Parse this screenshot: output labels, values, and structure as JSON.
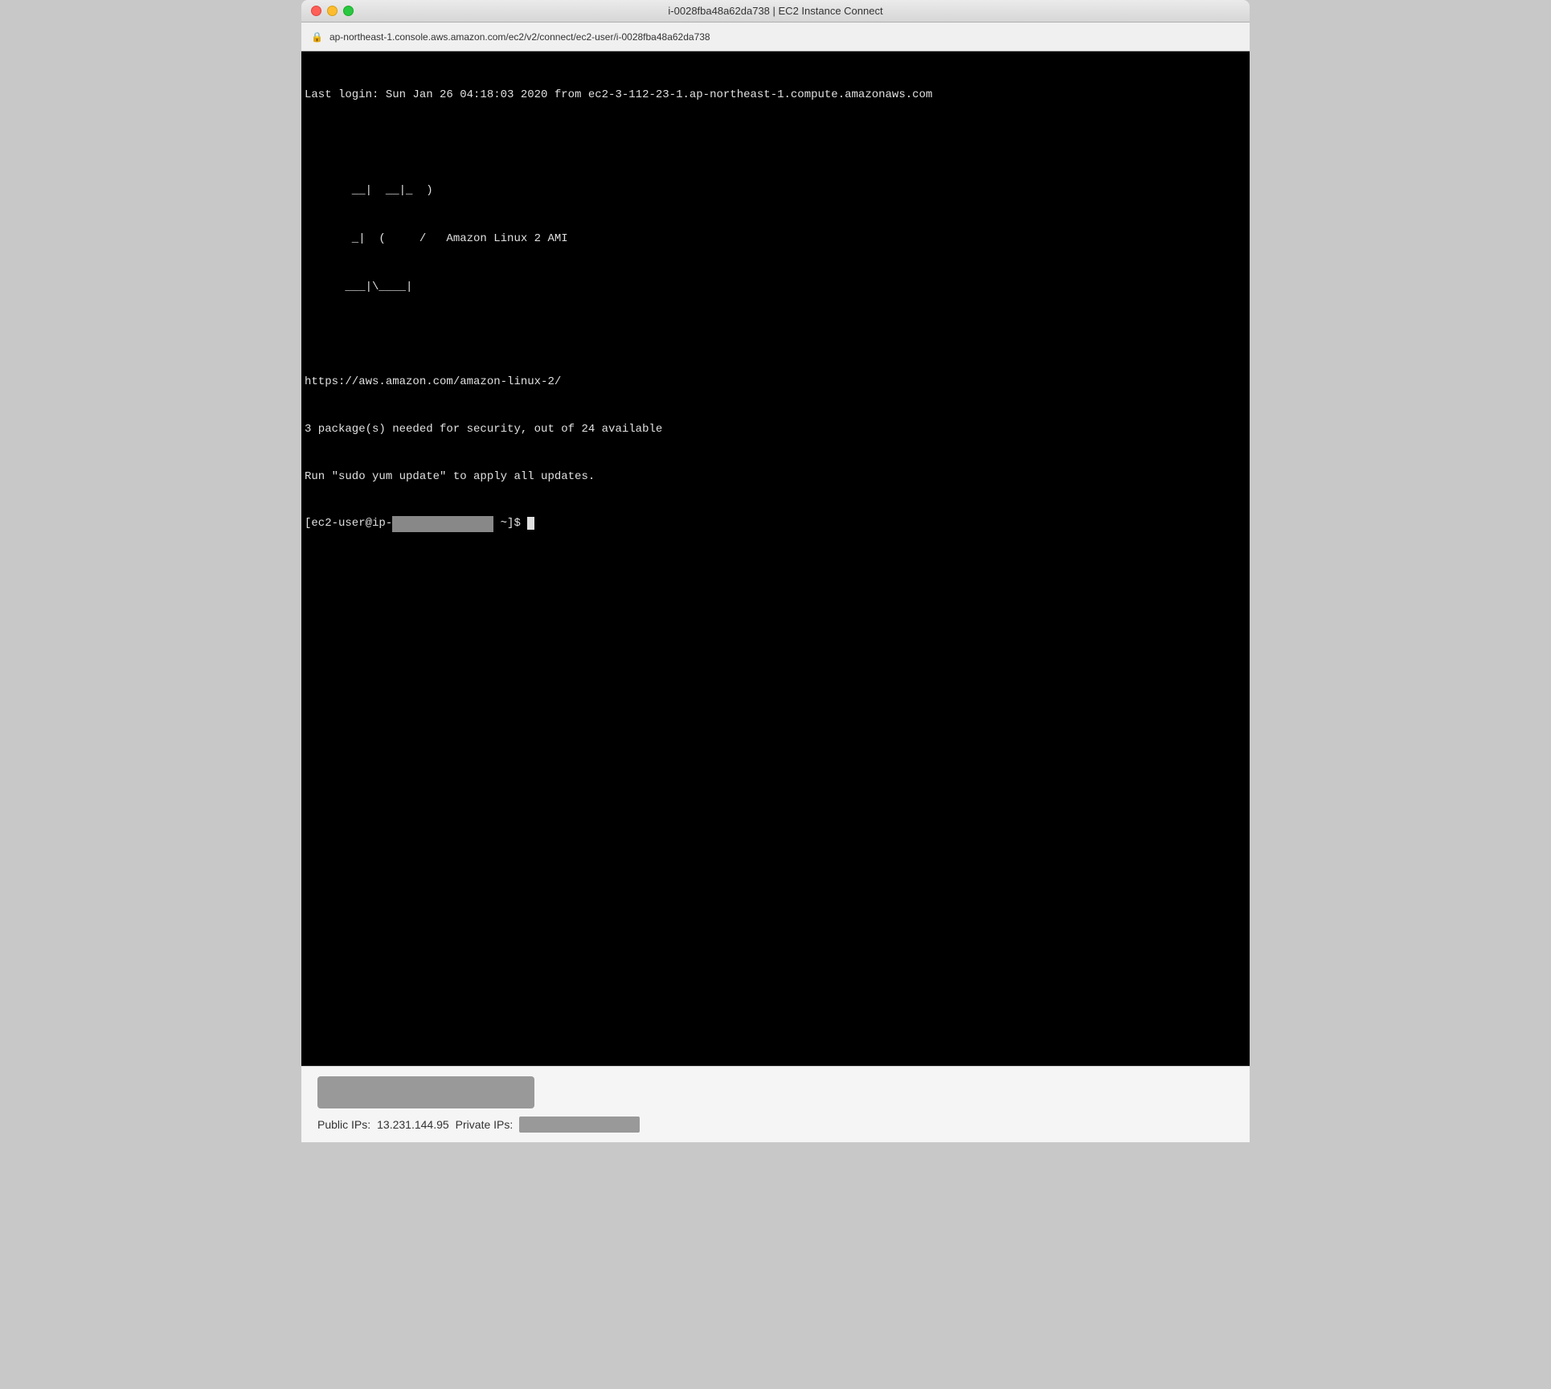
{
  "window": {
    "title": "i-0028fba48a62da738 | EC2 Instance Connect",
    "address": "ap-northeast-1.console.aws.amazon.com/ec2/v2/connect/ec2-user/i-0028fba48a62da738"
  },
  "terminal": {
    "last_login": "Last login: Sun Jan 26 04:18:03 2020 from ec2-3-112-23-1.ap-northeast-1.compute.amazonaws.com",
    "ascii_line1": "       __|  __|_  )",
    "ascii_line2": "       _|  (     /   Amazon Linux 2 AMI",
    "ascii_line3": "      ___|\\____|",
    "url_line": "https://aws.amazon.com/amazon-linux-2/",
    "packages_line": "3 package(s) needed for security, out of 24 available",
    "update_line": "Run \"sudo yum update\" to apply all updates.",
    "prompt_prefix": "[ec2-user@ip-",
    "prompt_redacted": "               ",
    "prompt_suffix": " ~]$ "
  },
  "bottom": {
    "public_ip_label": "Public IPs:",
    "public_ip_value": "13.231.144.95",
    "private_ip_label": "Private IPs:"
  }
}
